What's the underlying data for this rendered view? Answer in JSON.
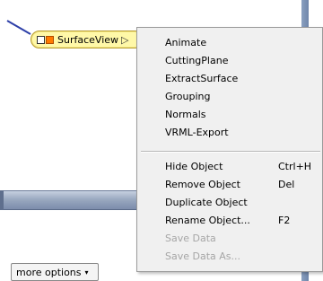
{
  "network": {
    "module_label": "SurfaceView",
    "module_port_icon": "triangle-right-icon",
    "colors": {
      "module_fill": "#fff8a8",
      "port_orange": "#ff7a00",
      "connection": "#2d3fa8"
    }
  },
  "more_options": {
    "label": "more options",
    "caret": "▾"
  },
  "menu": {
    "group1": [
      "Animate",
      "CuttingPlane",
      "ExtractSurface",
      "Grouping",
      "Normals",
      "VRML-Export"
    ],
    "group2": [
      {
        "label": "Hide Object",
        "shortcut": "Ctrl+H",
        "enabled": true
      },
      {
        "label": "Remove Object",
        "shortcut": "Del",
        "enabled": true
      },
      {
        "label": "Duplicate Object",
        "shortcut": "",
        "enabled": true
      },
      {
        "label": "Rename Object...",
        "shortcut": "F2",
        "enabled": true
      },
      {
        "label": "Save Data",
        "shortcut": "",
        "enabled": false
      },
      {
        "label": "Save Data As...",
        "shortcut": "",
        "enabled": false
      }
    ]
  }
}
